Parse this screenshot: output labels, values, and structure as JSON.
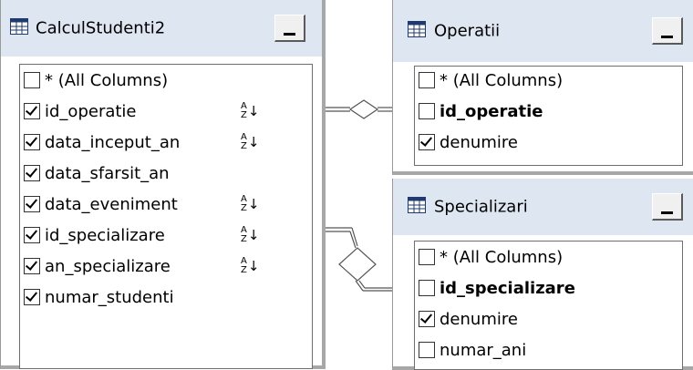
{
  "tables": [
    {
      "title": "CalculStudenti2",
      "columns": [
        {
          "label": "* (All Columns)",
          "checked": false,
          "bold": false,
          "sort": false
        },
        {
          "label": "id_operatie",
          "checked": true,
          "bold": false,
          "sort": true
        },
        {
          "label": "data_inceput_an",
          "checked": true,
          "bold": false,
          "sort": true
        },
        {
          "label": "data_sfarsit_an",
          "checked": true,
          "bold": false,
          "sort": false
        },
        {
          "label": "data_eveniment",
          "checked": true,
          "bold": false,
          "sort": true
        },
        {
          "label": "id_specializare",
          "checked": true,
          "bold": false,
          "sort": true
        },
        {
          "label": "an_specializare",
          "checked": true,
          "bold": false,
          "sort": true
        },
        {
          "label": "numar_studenti",
          "checked": true,
          "bold": false,
          "sort": false
        }
      ]
    },
    {
      "title": "Operatii",
      "columns": [
        {
          "label": "* (All Columns)",
          "checked": false,
          "bold": false
        },
        {
          "label": "id_operatie",
          "checked": false,
          "bold": true
        },
        {
          "label": "denumire",
          "checked": true,
          "bold": false
        }
      ]
    },
    {
      "title": "Specializari",
      "columns": [
        {
          "label": "* (All Columns)",
          "checked": false,
          "bold": false
        },
        {
          "label": "id_specializare",
          "checked": false,
          "bold": true
        },
        {
          "label": "denumire",
          "checked": true,
          "bold": false
        },
        {
          "label": "numar_ani",
          "checked": false,
          "bold": false
        }
      ]
    }
  ],
  "icons": {
    "table": "table-grid-icon",
    "sort": "sort-ascending-icon",
    "minimize": "minimize-icon"
  },
  "colors": {
    "title_bar": "#dde6f1",
    "frame_border": "#a7a7a7"
  }
}
